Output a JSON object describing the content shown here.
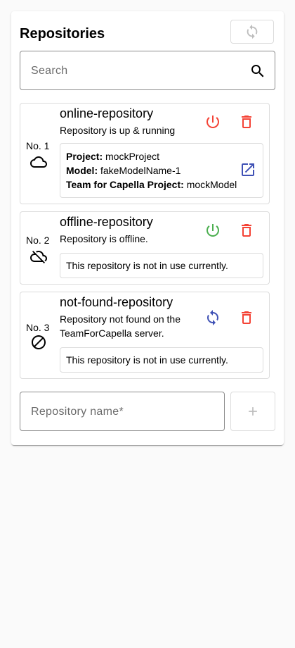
{
  "header": {
    "title": "Repositories"
  },
  "search": {
    "placeholder": "Search"
  },
  "repositories": [
    {
      "number": "No. 1",
      "name": "online-repository",
      "status_text": "Repository is up & running",
      "status_icon": "cloud-icon",
      "action_icon": "power-icon",
      "action_color": "#f44336",
      "details": [
        {
          "label": "Project:",
          "value": "mockProject"
        },
        {
          "label": "Model:",
          "value": "fakeModelName-1"
        },
        {
          "label": "Team for Capella Project:",
          "value": "mockModel"
        }
      ]
    },
    {
      "number": "No. 2",
      "name": "offline-repository",
      "status_text": "Repository is offline.",
      "status_icon": "cloud-off-icon",
      "action_icon": "power-icon",
      "action_color": "#4caf50",
      "info_message": "This repository is not in use currently."
    },
    {
      "number": "No. 3",
      "name": "not-found-repository",
      "status_text": "Repository not found on the TeamForCapella server.",
      "status_icon": "block-icon",
      "action_icon": "sync-icon",
      "action_color": "#3f51b5",
      "info_message": "This repository is not in use currently."
    }
  ],
  "new_repository": {
    "placeholder": "Repository name*"
  },
  "colors": {
    "delete": "#f44336",
    "link": "#3f51b5",
    "disabled": "#bdbdbd"
  }
}
